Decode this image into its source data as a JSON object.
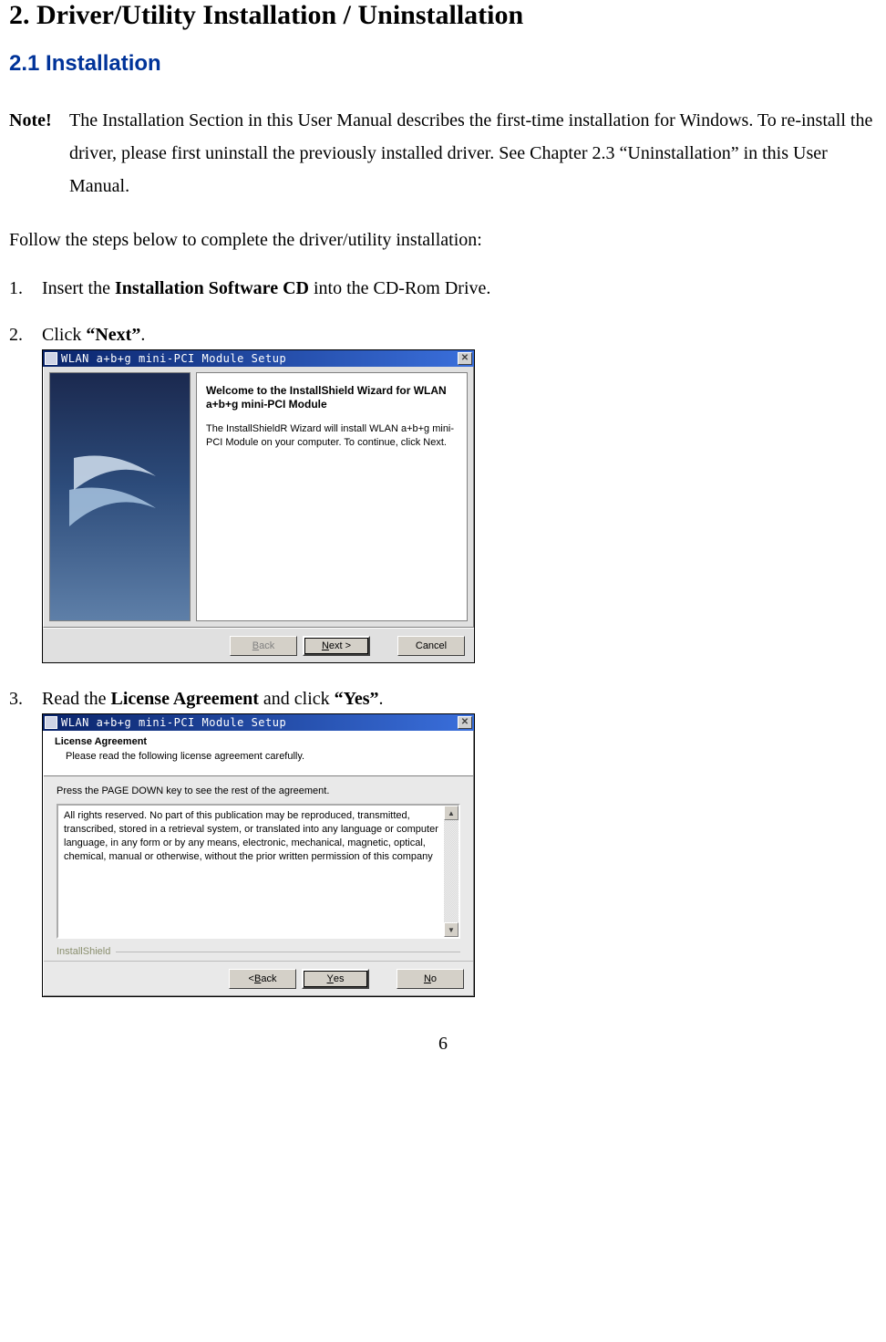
{
  "headings": {
    "main": "2. Driver/Utility Installation / Uninstallation",
    "sub": "2.1 Installation"
  },
  "note": {
    "label": "Note!",
    "text": "The Installation Section in this User Manual describes the first-time installation for Windows. To re-install the driver, please first uninstall the previously installed driver. See Chapter 2.3 “Uninstallation” in this User Manual."
  },
  "follow": "Follow the steps below to complete the driver/utility installation:",
  "steps": {
    "s1": {
      "num": "1.",
      "pre": "Insert the ",
      "bold": "Installation Software CD",
      "post": " into the CD-Rom Drive."
    },
    "s2": {
      "num": "2.",
      "pre": "Click ",
      "bold": "“Next”",
      "post": "."
    },
    "s3": {
      "num": "3.",
      "pre": "Read the ",
      "bold1": "License Agreement",
      "mid": " and click ",
      "bold2": "“Yes”",
      "post": "."
    }
  },
  "installer1": {
    "title": "WLAN a+b+g mini-PCI Module Setup",
    "welcome_title": "Welcome to the InstallShield Wizard for WLAN a+b+g mini-PCI Module",
    "welcome_text": "The InstallShieldR Wizard will install WLAN a+b+g mini-PCI Module on your computer.  To continue, click Next.",
    "buttons": {
      "back": "< Back",
      "next": "Next >",
      "cancel": "Cancel"
    }
  },
  "installer2": {
    "title": "WLAN a+b+g mini-PCI Module Setup",
    "header_title": "License Agreement",
    "header_sub": "Please read the following license agreement carefully.",
    "press_text": "Press the PAGE DOWN key to see the rest of the agreement.",
    "license_text": "All rights reserved. No part of this publication may be reproduced, transmitted, transcribed, stored in a retrieval system, or translated into any language or computer language, in any form or by any means, electronic, mechanical, magnetic, optical, chemical, manual or otherwise, without the prior written permission of this company",
    "brand": "InstallShield",
    "buttons": {
      "back": "< Back",
      "yes": "Yes",
      "no": "No"
    }
  },
  "page_number": "6"
}
